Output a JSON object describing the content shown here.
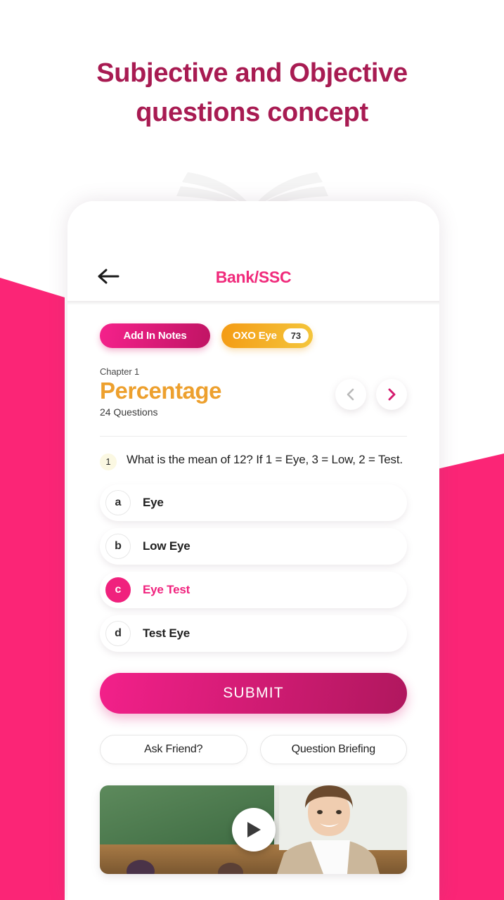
{
  "headline": "Subjective and Objective questions concept",
  "colors": {
    "brand_pink": "#FB2576",
    "headline_maroon": "#A81B52",
    "title_pink": "#F02A7B",
    "chapter_orange": "#EDA02E",
    "selected_pink": "#F0217D"
  },
  "app": {
    "header": {
      "back_icon": "arrow-left-icon",
      "title": "Bank/SSC"
    },
    "pills": {
      "notes_label": "Add In Notes",
      "oxo_label": "OXO Eye",
      "oxo_count": "73"
    },
    "chapter": {
      "label": "Chapter 1",
      "title": "Percentage",
      "count": "24 Questions",
      "prev_icon": "chevron-left-icon",
      "next_icon": "chevron-right-icon"
    },
    "question": {
      "number": "1",
      "text": "What is the mean of 12? If 1 = Eye, 3 = Low, 2 = Test.",
      "options": [
        {
          "letter": "a",
          "text": "Eye",
          "selected": false
        },
        {
          "letter": "b",
          "text": "Low Eye",
          "selected": false
        },
        {
          "letter": "c",
          "text": "Eye Test",
          "selected": true
        },
        {
          "letter": "d",
          "text": "Test Eye",
          "selected": false
        }
      ]
    },
    "submit_label": "SUBMIT",
    "actions": [
      {
        "label": "Ask Friend?"
      },
      {
        "label": "Question Briefing"
      }
    ],
    "video": {
      "play_icon": "play-icon",
      "alt": "classroom-teacher-thumbnail"
    }
  }
}
